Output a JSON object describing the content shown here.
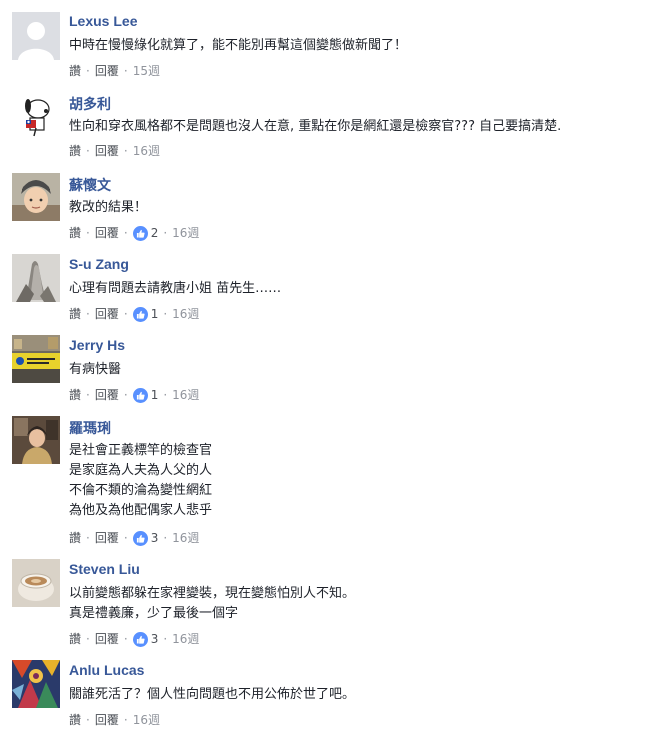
{
  "labels": {
    "like": "讚",
    "reply": "回覆",
    "dot": "·"
  },
  "colors": {
    "name": "#385898",
    "like_icon": "#5890ff",
    "muted": "#90949c"
  },
  "comments": [
    {
      "author": "Lexus Lee",
      "avatar_icon": "default-user-icon",
      "lines": [
        "中時在慢慢綠化就算了，能不能別再幫這個變態做新聞了！"
      ],
      "likes": null,
      "time": "15週"
    },
    {
      "author": "胡多利",
      "avatar_icon": "snoopy-avatar-icon",
      "lines": [
        "性向和穿衣風格都不是問題也沒人在意, 重點在你是網紅還是檢察官??? 自己要搞清楚."
      ],
      "likes": null,
      "time": "16週"
    },
    {
      "author": "蘇懷文",
      "avatar_icon": "child-photo-avatar-icon",
      "lines": [
        "教改的結果！"
      ],
      "likes": "2",
      "time": "16週"
    },
    {
      "author": "S-u Zang",
      "avatar_icon": "praying-hands-avatar-icon",
      "lines": [
        "心理有問題去請教唐小姐 苗先生……"
      ],
      "likes": "1",
      "time": "16週"
    },
    {
      "author": "Jerry Hs",
      "avatar_icon": "protest-banner-avatar-icon",
      "lines": [
        "有病快醫"
      ],
      "likes": "1",
      "time": "16週"
    },
    {
      "author": "羅瑪琍",
      "avatar_icon": "woman-photo-avatar-icon",
      "lines": [
        "是社會正義標竿的檢查官",
        "是家庭為人夫為人父的人",
        "不倫不類的淪為變性網紅",
        "為他及為他配偶家人悲乎"
      ],
      "likes": "3",
      "time": "16週"
    },
    {
      "author": "Steven Liu",
      "avatar_icon": "coffee-cup-avatar-icon",
      "lines": [
        "以前變態都躲在家裡變裝，現在變態怕別人不知。",
        "真是禮義廉，少了最後一個字"
      ],
      "likes": "3",
      "time": "16週"
    },
    {
      "author": "Anlu Lucas",
      "avatar_icon": "art-painting-avatar-icon",
      "lines": [
        "關誰死活了？個人性向問題也不用公佈於世了吧。"
      ],
      "likes": null,
      "time": "16週"
    }
  ]
}
